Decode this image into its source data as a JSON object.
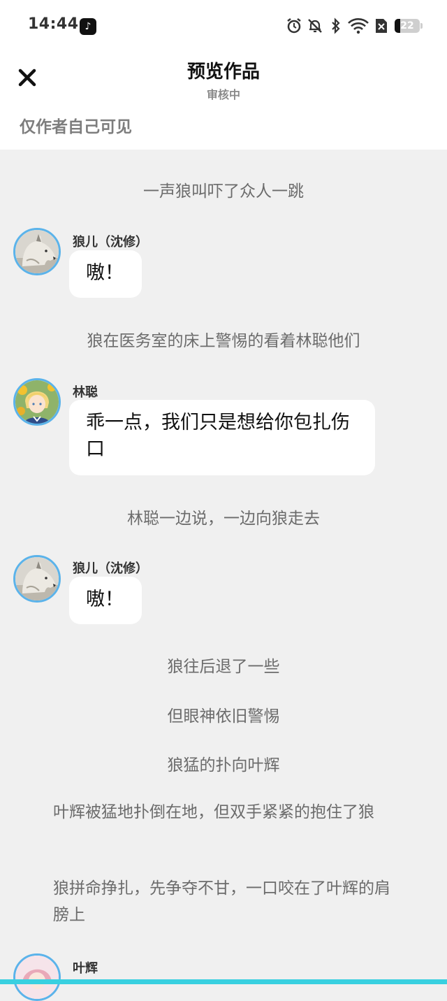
{
  "status_bar": {
    "time": "14:44",
    "app_badge": "♪",
    "battery_level": "22",
    "icons": [
      "alarm-icon",
      "dnd-icon",
      "bluetooth-icon",
      "wifi-icon",
      "sim-icon"
    ]
  },
  "header": {
    "title": "预览作品",
    "subtitle": "审核中",
    "visibility": "仅作者自己可见"
  },
  "story": {
    "narration_1": "一声狼叫吓了众人一跳",
    "msg_1": {
      "name": "狼儿（沈修）",
      "text": "嗷！"
    },
    "narration_2": "狼在医务室的床上警惕的看着林聪他们",
    "msg_2": {
      "name": "林聪",
      "text": "乖一点，我们只是想给你包扎伤口"
    },
    "narration_3": "林聪一边说，一边向狼走去",
    "msg_3": {
      "name": "狼儿（沈修）",
      "text": "嗷！"
    },
    "narration_4": "狼往后退了一些",
    "narration_5": "但眼神依旧警惕",
    "narration_6": "狼猛的扑向叶辉",
    "narration_7": "叶辉被猛地扑倒在地，但双手紧紧的抱住了狼",
    "narration_8": "狼拼命挣扎，先争夺不甘，一口咬在了叶辉的肩膀上",
    "msg_4": {
      "name": "叶辉"
    }
  },
  "colors": {
    "background": "#f0f0f0",
    "bubble": "#ffffff",
    "avatar_ring": "#5bb3ea",
    "accent_bar": "#39d0e0"
  }
}
